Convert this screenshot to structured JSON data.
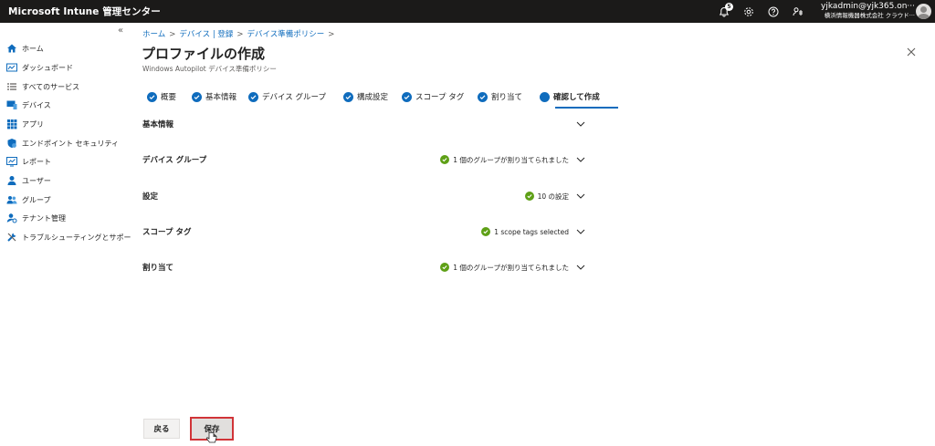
{
  "app": {
    "title": "Microsoft Intune 管理センター"
  },
  "topbar": {
    "notification_count": "5",
    "account_email": "yjkadmin@yjk365.on···",
    "account_org": "横浜情報機器株式会社 クラウド···"
  },
  "sidebar": {
    "collapse_glyph": "«",
    "items": [
      {
        "label": "ホーム",
        "icon": "home-icon"
      },
      {
        "label": "ダッシュボード",
        "icon": "dashboard-icon"
      },
      {
        "label": "すべてのサービス",
        "icon": "list-icon"
      },
      {
        "label": "デバイス",
        "icon": "devices-icon"
      },
      {
        "label": "アプリ",
        "icon": "apps-icon"
      },
      {
        "label": "エンドポイント セキュリティ",
        "icon": "endpoint-security-icon"
      },
      {
        "label": "レポート",
        "icon": "reports-icon"
      },
      {
        "label": "ユーザー",
        "icon": "user-icon"
      },
      {
        "label": "グループ",
        "icon": "groups-icon"
      },
      {
        "label": "テナント管理",
        "icon": "tenant-admin-icon"
      },
      {
        "label": "トラブルシューティングとサポート",
        "icon": "troubleshoot-icon"
      }
    ]
  },
  "breadcrumb": [
    "ホーム",
    "デバイス | 登録",
    "デバイス準備ポリシー"
  ],
  "page": {
    "title": "プロファイルの作成",
    "more_glyph": "···",
    "subtitle": "Windows Autopilot デバイス準備ポリシー"
  },
  "steps": [
    {
      "label": "概要",
      "state": "complete"
    },
    {
      "label": "基本情報",
      "state": "complete"
    },
    {
      "label": "デバイス グループ",
      "state": "complete"
    },
    {
      "label": "構成設定",
      "state": "complete"
    },
    {
      "label": "スコープ タグ",
      "state": "complete"
    },
    {
      "label": "割り当て",
      "state": "complete"
    },
    {
      "label": "確認して作成",
      "state": "current"
    }
  ],
  "sections": [
    {
      "title": "基本情報",
      "status": ""
    },
    {
      "title": "デバイス グループ",
      "status": "1 個のグループが割り当てられました"
    },
    {
      "title": "設定",
      "status": "10 の設定"
    },
    {
      "title": "スコープ タグ",
      "status": "1 scope tags selected"
    },
    {
      "title": "割り当て",
      "status": "1 個のグループが割り当てられました"
    }
  ],
  "footer": {
    "back_label": "戻る",
    "save_label": "保存"
  },
  "colors": {
    "accent": "#0f6cbd",
    "success": "#5ea016",
    "highlight": "#d13438",
    "topbar": "#1b1a19"
  }
}
